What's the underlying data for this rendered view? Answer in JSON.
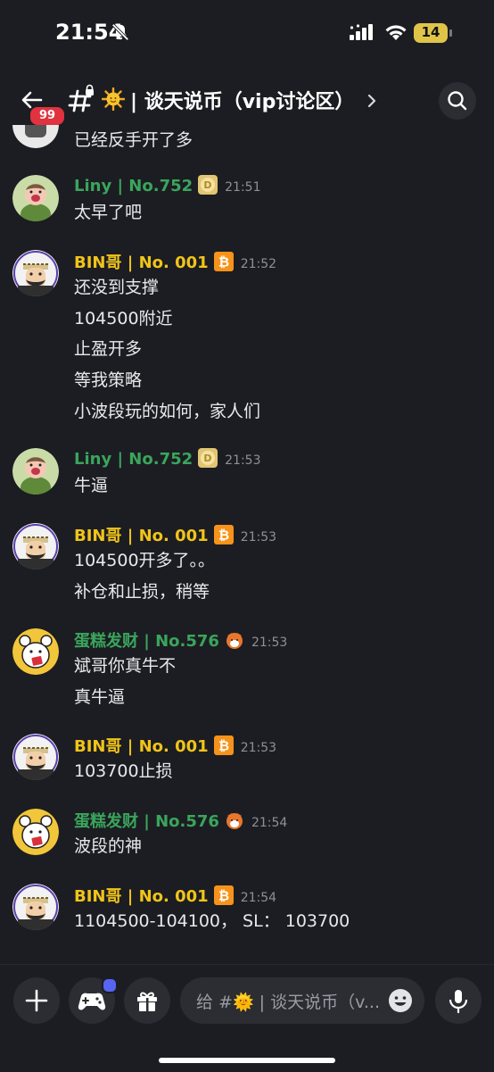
{
  "status_bar": {
    "time": "21:54",
    "battery": "14"
  },
  "header": {
    "badge": "99",
    "channel_title": "| 谈天说币（vip讨论区）"
  },
  "partial_message": {
    "text": "已经反手开了多"
  },
  "messages": [
    {
      "author": "Liny | No.752",
      "time": "21:51",
      "lines": [
        "太早了吧"
      ],
      "name_color": "#3aa55c"
    },
    {
      "author": "BIN哥 | No. 001",
      "time": "21:52",
      "lines": [
        "还没到支撑",
        "104500附近",
        "止盈开多",
        "等我策略",
        "小波段玩的如何，家人们"
      ],
      "name_color": "#f0c419"
    },
    {
      "author": "Liny | No.752",
      "time": "21:53",
      "lines": [
        "牛逼"
      ],
      "name_color": "#3aa55c"
    },
    {
      "author": "BIN哥 | No. 001",
      "time": "21:53",
      "lines": [
        "104500开多了。。",
        "补仓和止损，稍等"
      ],
      "name_color": "#f0c419"
    },
    {
      "author": "蛋糕发财 | No.576",
      "time": "21:53",
      "lines": [
        "斌哥你真牛不",
        "真牛逼"
      ],
      "name_color": "#3aa55c"
    },
    {
      "author": "BIN哥 | No. 001",
      "time": "21:53",
      "lines": [
        "103700止损"
      ],
      "name_color": "#f0c419"
    },
    {
      "author": "蛋糕发财 | No.576",
      "time": "21:54",
      "lines": [
        "波段的神"
      ],
      "name_color": "#3aa55c"
    },
    {
      "author": "BIN哥 | No. 001",
      "time": "21:54",
      "lines": [
        "1104500-104100， SL： 103700"
      ],
      "name_color": "#f0c419"
    }
  ],
  "composer": {
    "placeholder": "给 #🌞 | 谈天说币（v..."
  },
  "icons": [
    "bell-slash-icon",
    "signal-icon",
    "wifi-icon",
    "back-arrow-icon",
    "hash-lock-icon",
    "sun-emoji-icon",
    "chevron-right-icon",
    "search-icon",
    "dogecoin-icon",
    "bitcoin-icon",
    "shiba-icon",
    "plus-icon",
    "gamepad-icon",
    "gift-icon",
    "emoji-icon",
    "microphone-icon"
  ]
}
